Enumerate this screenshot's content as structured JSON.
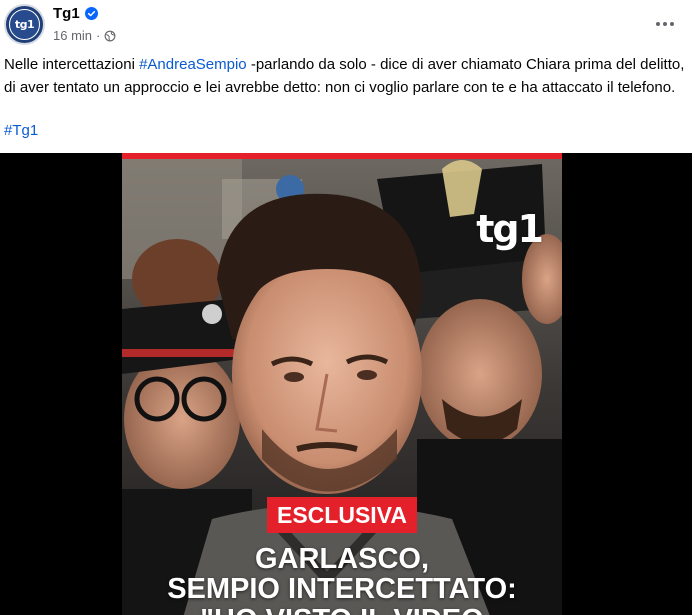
{
  "post": {
    "page_name": "Tg1",
    "timestamp": "16 min",
    "meta_separator": "·",
    "avatar_text": "tg1",
    "text_prefix": "Nelle intercettazioni ",
    "text_hashtag": "#AndreaSempio",
    "text_body": " -parlando da solo - dice di aver chiamato Chiara prima del delitto, di aver tentato un approccio e lei avrebbe detto: non ci voglio parlare con te e ha attaccato il telefono.",
    "footer_hashtag": "#Tg1",
    "accent_color": "#0a5bd3"
  },
  "media": {
    "logo_text": "tg1",
    "badge_text": "ESCLUSIVA",
    "headline_line1": "GARLASCO,",
    "headline_line2": "SEMPIO INTERCETTATO:",
    "headline_line3": "\"HO VISTO IL VIDEO",
    "brand_red": "#e4202a"
  },
  "icons": {
    "verified": "verified-badge-icon",
    "audience": "globe-icon",
    "more": "more-options-icon"
  }
}
